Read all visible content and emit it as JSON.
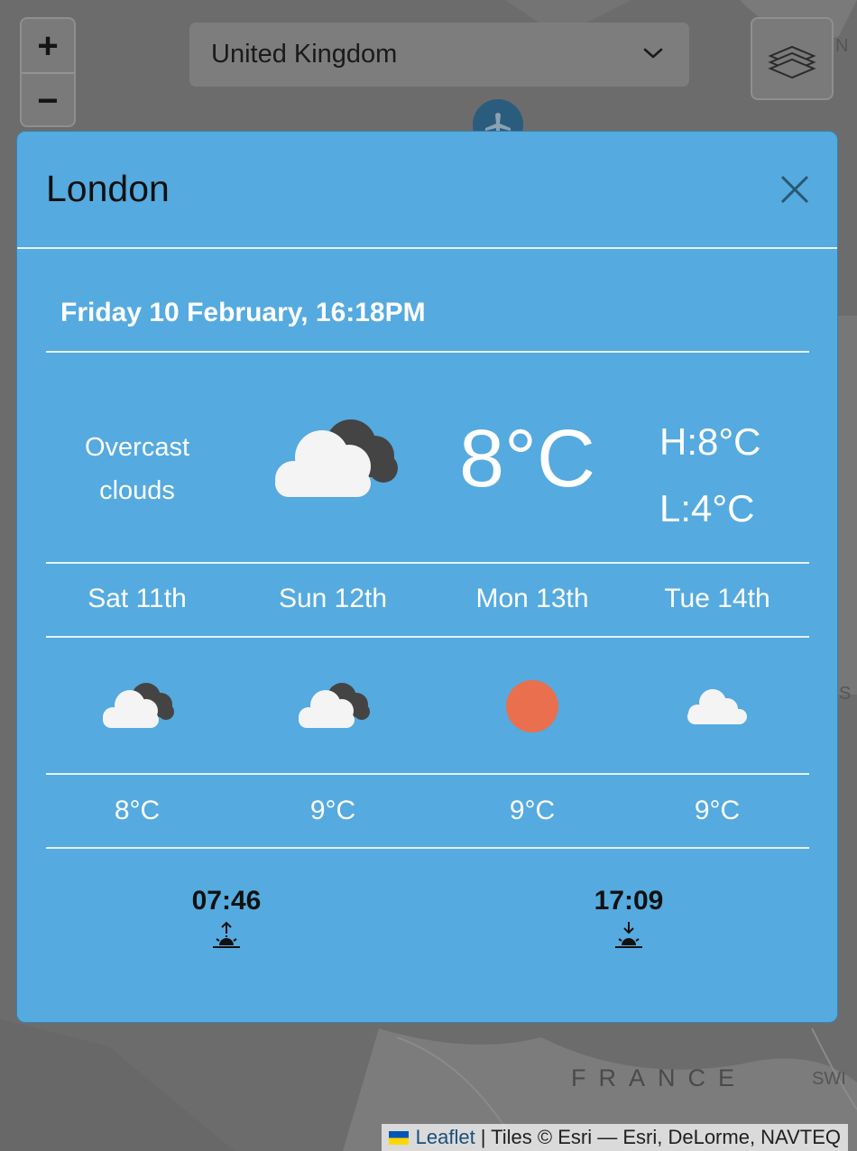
{
  "map": {
    "zoom_in_label": "+",
    "zoom_out_label": "−",
    "country_select": {
      "value": "United Kingdom"
    },
    "map_label_france": "FRANCE",
    "edge_label_n": "N",
    "edge_label_swi": "SWI",
    "edge_label_s": "S"
  },
  "attribution": {
    "leaflet": "Leaflet",
    "rest": "| Tiles © Esri — Esri, DeLorme, NAVTEQ"
  },
  "modal": {
    "title": "London",
    "datetime": "Friday 10 February, 16:18PM",
    "current": {
      "condition_line1": "Overcast",
      "condition_line2": "clouds",
      "condition_icon": "broken-clouds-icon",
      "temp": "8°C",
      "high": "H:8°C",
      "low": "L:4°C"
    },
    "forecast": [
      {
        "day": "Sat 11th",
        "icon": "broken-clouds-icon",
        "temp": "8°C"
      },
      {
        "day": "Sun 12th",
        "icon": "broken-clouds-icon",
        "temp": "9°C"
      },
      {
        "day": "Mon 13th",
        "icon": "sun-icon",
        "temp": "9°C"
      },
      {
        "day": "Tue 14th",
        "icon": "cloud-icon",
        "temp": "9°C"
      }
    ],
    "sunrise": "07:46",
    "sunset": "17:09"
  },
  "colors": {
    "modal_bg": "#55aadf",
    "sun": "#ea6f4e",
    "dark_cloud": "#444444",
    "light_cloud": "#f4f4f4"
  }
}
